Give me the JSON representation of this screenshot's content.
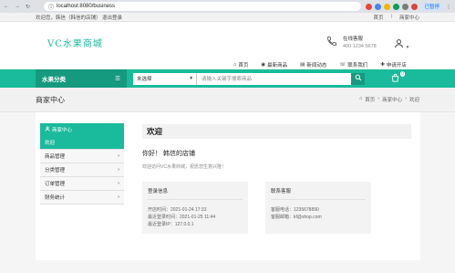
{
  "browser": {
    "url": "localhost:8080/business",
    "profile": "已暂停"
  },
  "topbar": {
    "welcome": "欢迎您，韩信（韩信的店铺）",
    "logout": "退出登录",
    "home": "首页",
    "center": "商家中心"
  },
  "logo": "VC水果商城",
  "contact": {
    "label": "在线客服",
    "phone": "400 1234 5678"
  },
  "menu": [
    {
      "icon": "home-icon",
      "label": "首页"
    },
    {
      "icon": "new-icon",
      "label": "最新商品"
    },
    {
      "icon": "news-icon",
      "label": "新闻动态"
    },
    {
      "icon": "phone-icon",
      "label": "联系我们"
    },
    {
      "icon": "apply-icon",
      "label": "申请开店"
    }
  ],
  "nav": {
    "category": "水果分类",
    "select": "未选择",
    "search_placeholder": "请输入关键字搜索商品",
    "cart_count": "0"
  },
  "page_title": "商家中心",
  "breadcrumb": [
    "首页",
    "商家中心",
    "欢迎"
  ],
  "sidebar": {
    "title": "商家中心",
    "items": [
      "欢迎",
      "商品管理",
      "分类管理",
      "订单管理",
      "财务统计"
    ]
  },
  "main": {
    "welcome_title": "欢迎",
    "greeting": "你好！ 韩信的店铺",
    "subtitle": "欢迎访问VC水果商城，祝愿您生意兴隆！",
    "login_box": {
      "title": "登录信息",
      "lines": [
        "开店时间：2021-01-24 17:33",
        "最近登录时间：2021-01-25 11:44",
        "最近登录IP：127.0.0.1"
      ]
    },
    "service_box": {
      "title": "联系客服",
      "lines": [
        "客服电话：1235678890",
        "客服邮箱：kf@shop.com"
      ]
    }
  },
  "colors": {
    "accent": "#1aba9c",
    "accent_dark": "#159a80"
  }
}
